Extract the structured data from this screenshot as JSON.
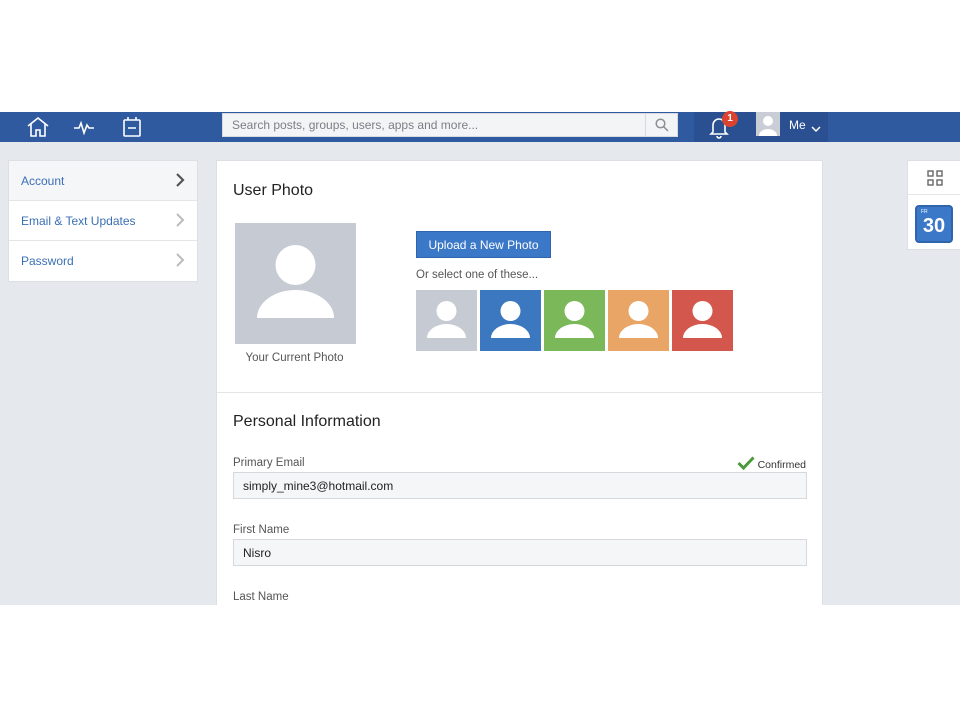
{
  "nav": {
    "icons": [
      "home-icon",
      "activity-icon",
      "apps-icon"
    ],
    "search_placeholder": "Search posts, groups, users, apps and more...",
    "notification_count": "1",
    "user_label": "Me"
  },
  "sidebar": {
    "items": [
      {
        "label": "Account",
        "active": true
      },
      {
        "label": "Email & Text Updates",
        "active": false
      },
      {
        "label": "Password",
        "active": false
      }
    ]
  },
  "photo": {
    "title": "User Photo",
    "current_caption": "Your Current Photo",
    "upload_label": "Upload a New Photo",
    "select_text": "Or select one of these...",
    "choice_colors": [
      "#c6cbd3",
      "#3b78c0",
      "#7ab85a",
      "#e8a566",
      "#d4574d"
    ]
  },
  "personal": {
    "title": "Personal Information",
    "email_label": "Primary Email",
    "email_value": "simply_mine3@hotmail.com",
    "email_status": "Confirmed",
    "first_label": "First Name",
    "first_value": "Nisro",
    "last_label": "Last Name"
  },
  "widgets": {
    "calendar_day": "FR",
    "calendar_date": "30"
  },
  "colors": {
    "nav_bar": "#2f5aa0",
    "accent": "#3b78c8",
    "confirmed_check": "#4a9a3c",
    "badge": "#d9432f"
  }
}
